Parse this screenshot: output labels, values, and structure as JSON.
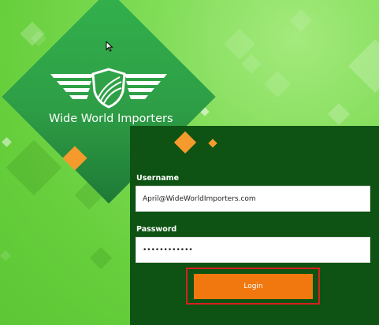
{
  "brand": {
    "title": "Wide World Importers",
    "logo_icon": "winged-shield-icon"
  },
  "login": {
    "username_label": "Username",
    "username_value": "April@WideWorldImporters.com",
    "password_label": "Password",
    "password_value": "••••••••••••",
    "login_button_label": "Login"
  },
  "colors": {
    "background_green": "#7fdc56",
    "brand_diamond": "#2e9e46",
    "panel": "#0e5313",
    "accent_orange": "#f59a2c",
    "button_orange": "#f0780f",
    "highlight_red": "#d81f1f"
  },
  "cursor_icon": "mouse-pointer-icon"
}
